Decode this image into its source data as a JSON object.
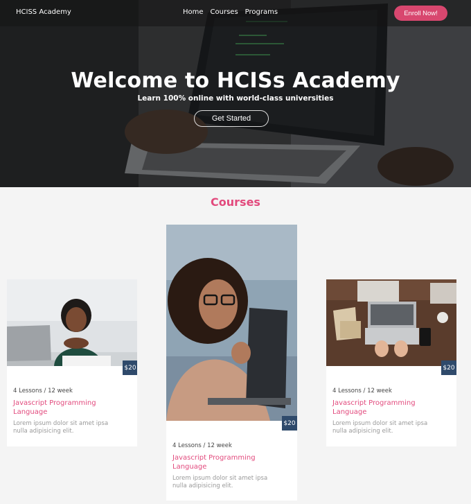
{
  "navbar": {
    "brand": "HCISS Academy",
    "links": [
      "Home",
      "Courses",
      "Programs"
    ],
    "cta_label": "Enroll Now!"
  },
  "hero": {
    "title": "Welcome to HCISs Academy",
    "subtitle": "Learn 100% online with world-class universities",
    "button_label": "Get Started"
  },
  "courses": {
    "section_title": "Courses",
    "cards": [
      {
        "price": "$20",
        "lessons": "4 Lessons / 12 week",
        "title": "Javascript Programming Language",
        "description": "Lorem ipsum dolor sit amet ipsa nulla adipisicing elit."
      },
      {
        "price": "$20",
        "lessons": "4 Lessons / 12 week",
        "title": "Javascript Programming Language",
        "description": "Lorem ipsum dolor sit amet ipsa nulla adipisicing elit."
      },
      {
        "price": "$20",
        "lessons": "4 Lessons / 12 week",
        "title": "Javascript Programming Language",
        "description": "Lorem ipsum dolor sit amet ipsa nulla adipisicing elit."
      }
    ]
  },
  "colors": {
    "accent_pink": "#e24a7d",
    "price_tag_bg": "#2f4a6b",
    "page_bg": "#f4f4f4"
  }
}
